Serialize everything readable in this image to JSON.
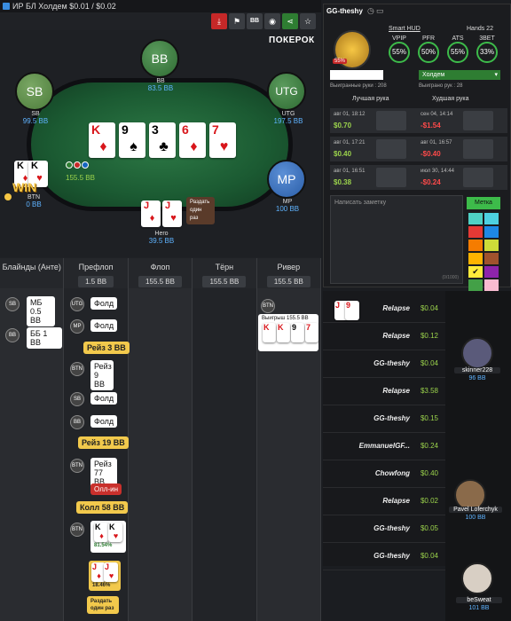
{
  "window": {
    "title": "ИР БЛ Холдем $0.01 / $0.02"
  },
  "toolbar": {
    "logo": "ПОКЕРОК",
    "bb_btn": "BB"
  },
  "seats": [
    {
      "pos": "BB",
      "name": "BB",
      "stack": "83.5 BB"
    },
    {
      "pos": "SB",
      "name": "SB",
      "stack": "99.5 BB"
    },
    {
      "pos": "UTG",
      "name": "UTG",
      "stack": "197.5 BB"
    },
    {
      "pos": "MP",
      "name": "MP",
      "stack": "100 BB"
    },
    {
      "pos": "BTN",
      "name": "BTN",
      "stack": "0 BB"
    },
    {
      "pos": "",
      "name": "Hero",
      "stack": "39.5 BB"
    }
  ],
  "board": [
    {
      "rank": "K",
      "suit": "♦",
      "red": true
    },
    {
      "rank": "9",
      "suit": "♠",
      "red": false
    },
    {
      "rank": "3",
      "suit": "♣",
      "red": false
    },
    {
      "rank": "6",
      "suit": "♦",
      "red": true
    },
    {
      "rank": "7",
      "suit": "♥",
      "red": true
    }
  ],
  "btn_hand": [
    {
      "rank": "K",
      "suit": "♦"
    },
    {
      "rank": "K",
      "suit": "♥"
    }
  ],
  "hero_hand": [
    {
      "rank": "J",
      "suit": "♦"
    },
    {
      "rank": "J",
      "suit": "♥"
    }
  ],
  "pot_chips": "155.5 BB",
  "win_badge": "WIN",
  "deal_twice": "Раздать один раз",
  "streets": [
    {
      "name": "Блайнды (Анте)",
      "pot": ""
    },
    {
      "name": "Префлоп",
      "pot": "1.5 BB"
    },
    {
      "name": "Флоп",
      "pot": "155.5 BB"
    },
    {
      "name": "Тёрн",
      "pot": "155.5 BB"
    },
    {
      "name": "Ривер",
      "pot": "155.5 BB"
    }
  ],
  "actions": {
    "sb_blind": "МБ 0.5 BB",
    "bb_blind": "ББ 1 BB",
    "utg_fold": "Фолд",
    "mp_fold": "Фолд",
    "raise3": "Рейз 3 BB",
    "btn_raise9": "Рейз 9 BB",
    "sb_fold": "Фолд",
    "bb_fold": "Фолд",
    "raise19": "Рейз 19 BB",
    "btn_raise77": "Рейз 77 BB",
    "allin": "Олл-ин",
    "call58": "Колл 58 BB",
    "btn_equity": "81.54%",
    "hero_equity": "18.46%",
    "river_win": "Выигрыш 155.5 BB",
    "river_cards": [
      "K",
      "K",
      "9",
      "7"
    ],
    "deal_once": "Раздать один раз"
  },
  "pos_labels": {
    "sb": "SB",
    "bb": "BB",
    "utg": "UTG",
    "mp": "MP",
    "btn": "BTN"
  },
  "hud": {
    "player": "GG-theshy",
    "smart_hud": "Smart HUD",
    "hands": "Hands 22",
    "stats": [
      {
        "label": "VPIP",
        "value": "55%"
      },
      {
        "label": "PFR",
        "value": "50%"
      },
      {
        "label": "ATS",
        "value": "55%"
      },
      {
        "label": "3BET",
        "value": "33%"
      }
    ],
    "avatar_pct": "55%",
    "game_select": "Холдем",
    "hands_won": "Выигранные руки : 208",
    "won_amount": "Выиграно рук : 28",
    "best_label": "Лучшая рука",
    "worst_label": "Худшая рука",
    "best": [
      {
        "date": "авг 01, 18:12",
        "amt": "$0.70"
      },
      {
        "date": "авг 01, 17:21",
        "amt": "$0.40"
      },
      {
        "date": "авг 01, 16:51",
        "amt": "$0.38"
      }
    ],
    "worst": [
      {
        "date": "сен 04, 14:14",
        "amt": "-$1.54"
      },
      {
        "date": "авг 01, 16:57",
        "amt": "-$0.40"
      },
      {
        "date": "июл 30, 14:44",
        "amt": "-$0.24"
      }
    ],
    "note_placeholder": "Написать заметку",
    "note_counter": "(0/1000)",
    "label_btn": "Метка",
    "swatches": [
      "#4fd1c5",
      "#4fd1c5",
      "#e53935",
      "#f57c00",
      "#ffb300",
      "#7b1fa2",
      "#e53935",
      "#1e88e5",
      "#cddc39",
      "#8e24aa",
      "#26a69a",
      "#f06292"
    ]
  },
  "hand_list": [
    {
      "name": "Relapse",
      "amt": "$0.04"
    },
    {
      "name": "Relapse",
      "amt": "$0.12"
    },
    {
      "name": "GG-theshy",
      "amt": "$0.04"
    },
    {
      "name": "Relapse",
      "amt": "$3.58"
    },
    {
      "name": "GG-theshy",
      "amt": "$0.15"
    },
    {
      "name": "EmmanuelGF...",
      "amt": "$0.24"
    },
    {
      "name": "Chowfong",
      "amt": "$0.40"
    },
    {
      "name": "Relapse",
      "amt": "$0.02"
    },
    {
      "name": "GG-theshy",
      "amt": "$0.05"
    },
    {
      "name": "GG-theshy",
      "amt": "$0.04"
    }
  ],
  "side_players": [
    {
      "name": "skinner228",
      "stack": "96 BB"
    },
    {
      "name": "Pavel Loferchyk",
      "stack": "100 BB"
    },
    {
      "name": "beSweat",
      "stack": "101 BB"
    }
  ]
}
